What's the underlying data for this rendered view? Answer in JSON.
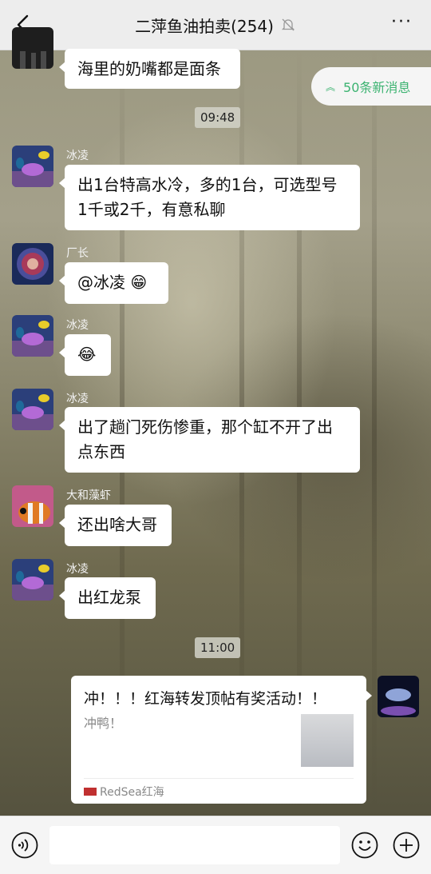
{
  "header": {
    "title": "二萍鱼油拍卖(254)",
    "more_label": "···"
  },
  "new_messages": {
    "label": "50条新消息"
  },
  "messages": [
    {
      "sender": "",
      "text": "海里的奶嘴都是面条"
    },
    {
      "time": "09:48"
    },
    {
      "sender": "冰凌",
      "text": "出1台特高水冷，多的1台，可选型号1千或2千，有意私聊"
    },
    {
      "sender": "厂长",
      "text": "@冰凌 😁"
    },
    {
      "sender": "冰凌",
      "text": "😂"
    },
    {
      "sender": "冰凌",
      "text": "出了趟门死伤惨重，那个缸不开了出点东西"
    },
    {
      "sender": "大和藻虾",
      "text": "还出啥大哥"
    },
    {
      "sender": "冰凌",
      "text": "出红龙泵"
    },
    {
      "time": "11:00"
    }
  ],
  "link_card": {
    "title": "冲！！！红海转发顶帖有奖活动！！",
    "desc": "冲鸭！",
    "source": "RedSea红海"
  },
  "colors": {
    "accent_green": "#3cb371",
    "header_bg": "#ededed"
  },
  "icons": [
    "back-icon",
    "mute-icon",
    "more-icon",
    "voice-icon",
    "emoji-icon",
    "plus-icon"
  ]
}
